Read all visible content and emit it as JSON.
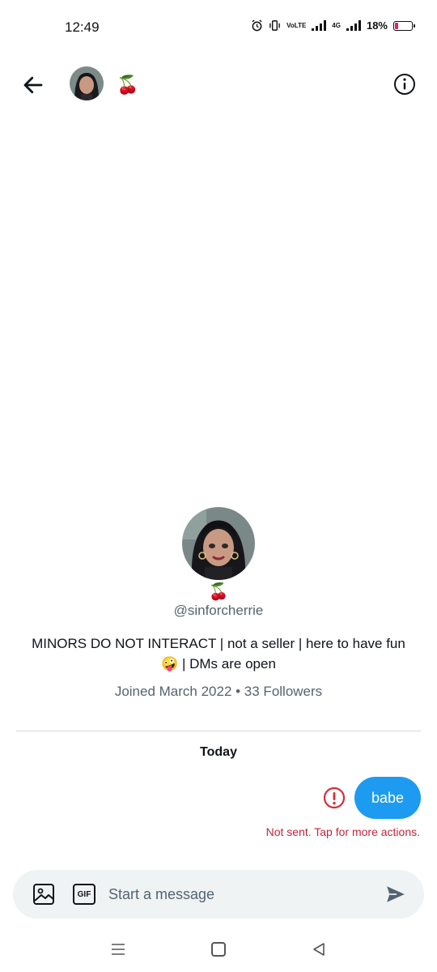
{
  "status_bar": {
    "time": "12:49",
    "network_label": "VoLTE",
    "network_type": "4G",
    "battery_percent": "18%",
    "battery_level": 0.18
  },
  "header": {
    "name_emoji": "🍒"
  },
  "profile": {
    "name_emoji": "🍒",
    "handle": "@sinforcherrie",
    "bio_line1": "MINORS DO NOT INTERACT | not a seller | here to have fun",
    "bio_line2": "🤪 | DMs are open",
    "meta": "Joined March 2022 • 33 Followers"
  },
  "conversation": {
    "date_label": "Today",
    "messages": [
      {
        "text": "babe",
        "status": "Not sent. Tap for more actions."
      }
    ]
  },
  "composer": {
    "gif_label": "GIF",
    "placeholder": "Start a message"
  },
  "colors": {
    "accent": "#1d9bf0",
    "error": "#c0263d",
    "secondary_text": "#536471"
  }
}
